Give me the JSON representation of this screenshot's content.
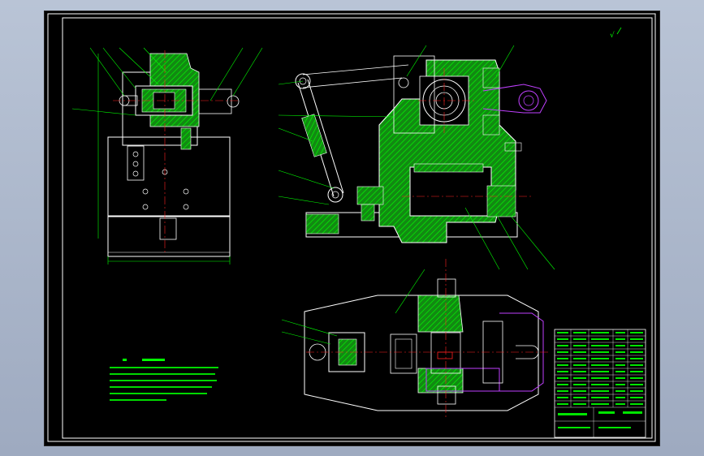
{
  "app": {
    "background": "#a9b4c9",
    "viewport_background": "#000000"
  },
  "colors": {
    "frame": "#ffffff",
    "outline": "#ffffff",
    "section_fill": "#17a317",
    "hatch": "#00ff00",
    "centerline": "#ff2020",
    "dimension": "#00ff00",
    "leader": "#00ff00",
    "phantom": "#c040ff",
    "notes": "#00ff00",
    "titleblock": "#00ff00"
  },
  "drawing": {
    "views": [
      "side-view",
      "front-view",
      "top-view"
    ],
    "roughness_symbol": "√",
    "title_block": {
      "rows": 9,
      "cols": 4
    }
  }
}
